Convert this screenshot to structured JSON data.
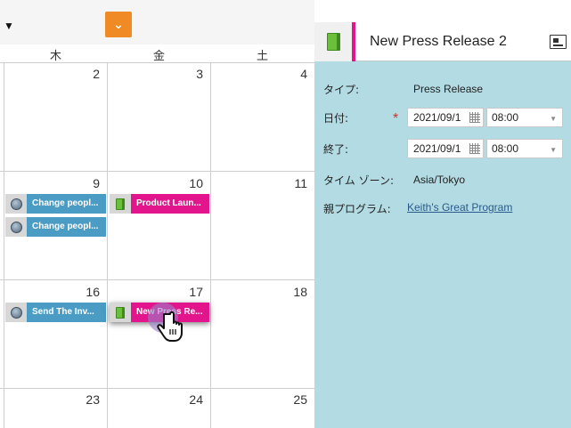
{
  "toolbar": {
    "dropdown_caret": "▼",
    "action_icon": "chevron-down-icon"
  },
  "calendar": {
    "weekdays": [
      "木",
      "金",
      "土"
    ],
    "days": [
      "2",
      "3",
      "4",
      "9",
      "10",
      "11",
      "16",
      "17",
      "18",
      "23",
      "24",
      "25"
    ],
    "events": [
      {
        "label": "Change peopl...",
        "icon": "email-program-icon",
        "color": "#4a9cc4"
      },
      {
        "label": "Change peopl...",
        "icon": "email-program-icon",
        "color": "#4a9cc4"
      },
      {
        "label": "Product Laun...",
        "icon": "press-release-book-icon",
        "color": "#e3158c"
      },
      {
        "label": "Send The Inv...",
        "icon": "email-program-icon",
        "color": "#4a9cc4"
      },
      {
        "label": "New Press Re...",
        "icon": "press-release-book-icon",
        "color": "#e3158c"
      }
    ]
  },
  "details": {
    "title": "New Press Release 2",
    "type_label": "タイプ:",
    "type_value": "Press Release",
    "date_label": "日付:",
    "date_value": "2021/09/1",
    "date_time": "08:00",
    "end_label": "終了:",
    "end_value": "2021/09/1",
    "end_time": "08:00",
    "timezone_label": "タイム ゾーン:",
    "timezone_value": "Asia/Tokyo",
    "parent_label": "親プログラム:",
    "parent_value": "Keith's Great Program",
    "required_mark": "*"
  },
  "colors": {
    "accent_orange": "#f08a24",
    "pink": "#e3158c",
    "blue": "#4a9cc4",
    "panel_bg": "#b3dbe3"
  }
}
